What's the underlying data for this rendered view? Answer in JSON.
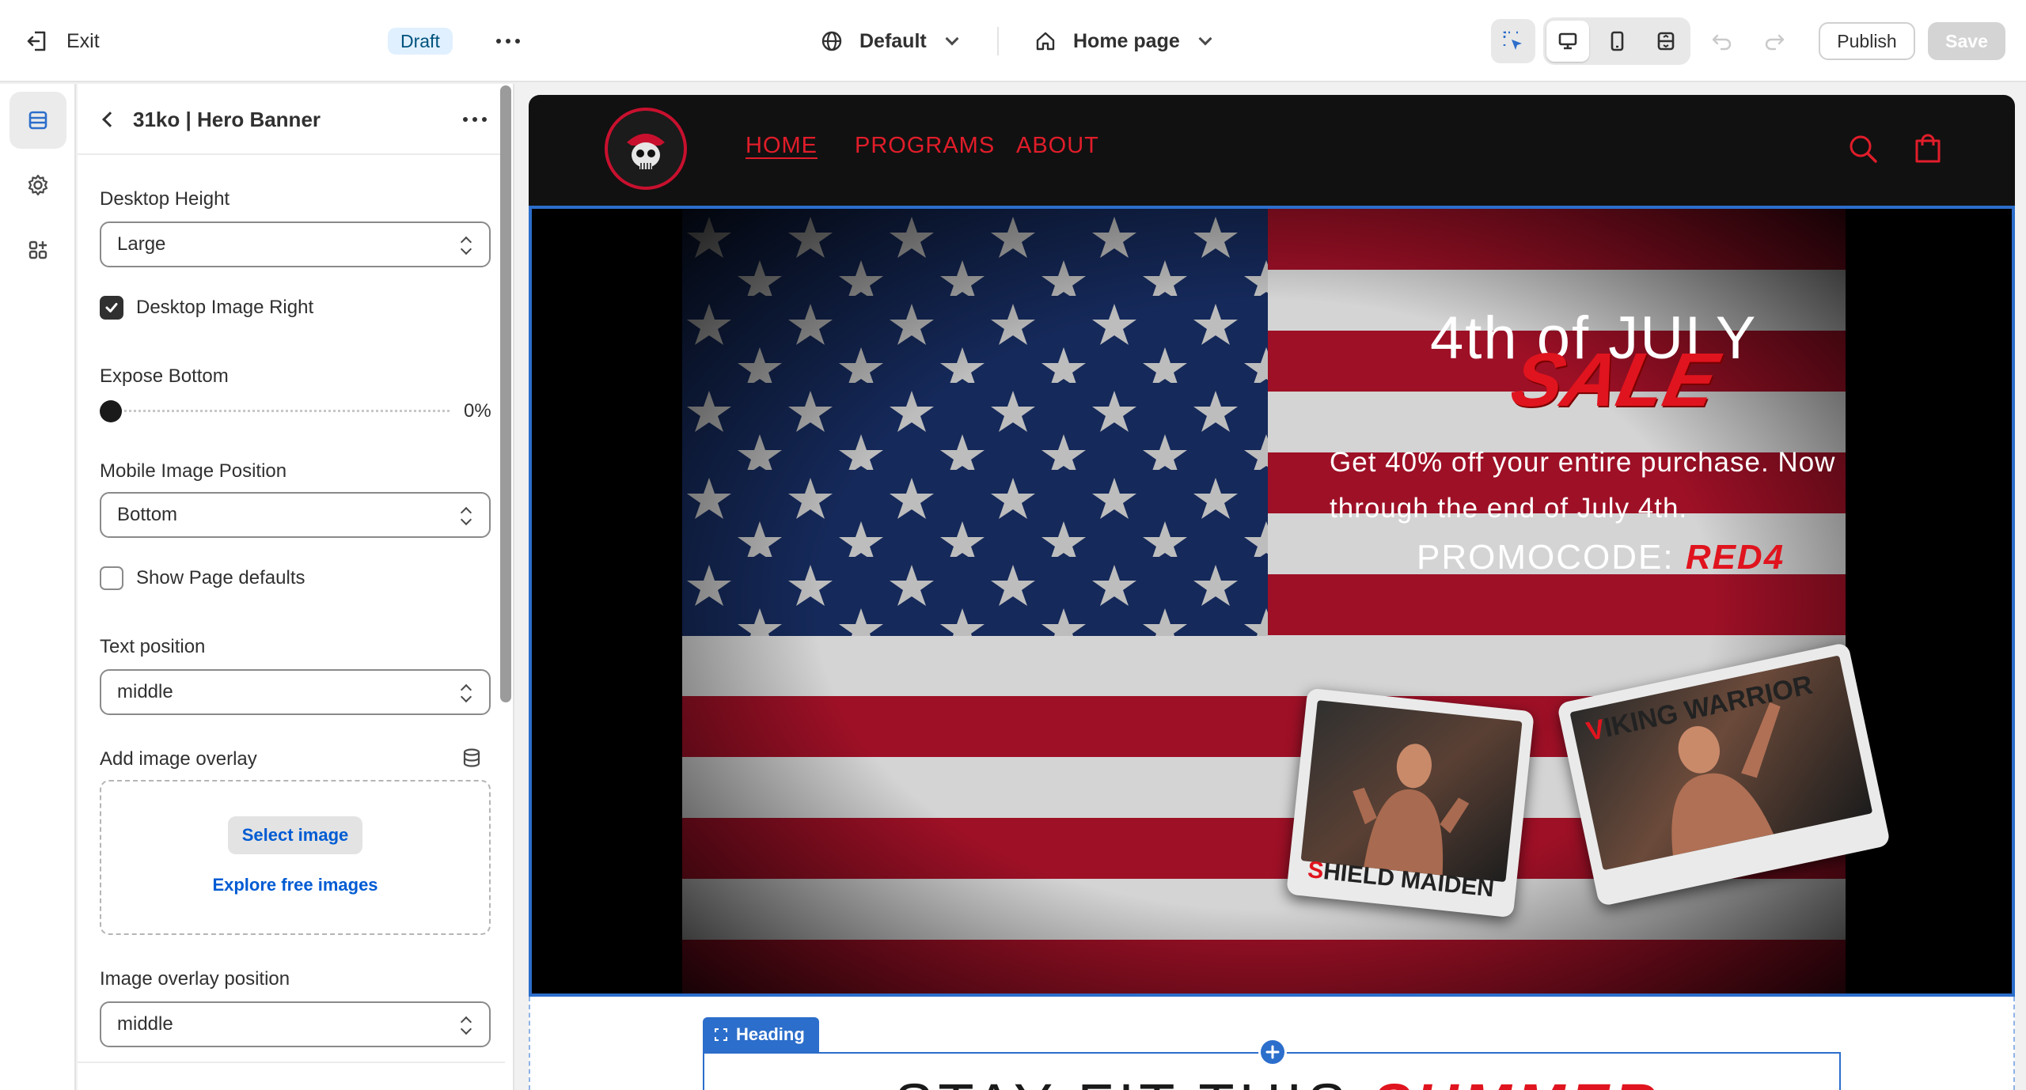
{
  "topbar": {
    "exit_label": "Exit",
    "status_badge": "Draft",
    "theme_select": "Default",
    "page_select": "Home page",
    "publish_label": "Publish",
    "save_label": "Save"
  },
  "panel": {
    "title": "31ko | Hero Banner",
    "desktop_height": {
      "label": "Desktop Height",
      "value": "Large"
    },
    "desktop_image_right": {
      "label": "Desktop Image Right",
      "checked": true
    },
    "expose_bottom": {
      "label": "Expose Bottom",
      "value": "0%"
    },
    "mobile_image_position": {
      "label": "Mobile Image Position",
      "value": "Bottom"
    },
    "show_page_defaults": {
      "label": "Show Page defaults",
      "checked": false
    },
    "text_position": {
      "label": "Text position",
      "value": "middle"
    },
    "image_overlay": {
      "label": "Add image overlay",
      "select_button": "Select image",
      "explore_link": "Explore free images"
    },
    "overlay_position": {
      "label": "Image overlay position",
      "value": "middle"
    }
  },
  "site": {
    "nav": [
      "HOME",
      "PROGRAMS",
      "ABOUT"
    ],
    "hero": {
      "title": "4th of JULY",
      "sale": "SALE",
      "body": "Get 40% off your entire purchase. Now through the end of July 4th.",
      "promo_prefix": "PROMOCODE:",
      "promo_code": "RED4",
      "photo_right_rest": "IKING WARRIOR",
      "photo_right_initial": "V",
      "photo_left_initial": "S",
      "photo_left_rest": "HIELD MAIDEN"
    },
    "heading_badge": "Heading",
    "heading_text": "STAY FIT THIS",
    "heading_red": "SUMMER"
  },
  "colors": {
    "accent": "#2c6ecb",
    "brand_red": "#e0141e",
    "draft_bg": "#e0f0ff"
  },
  "icons": [
    "exit-icon",
    "more-icon",
    "globe-icon",
    "home-icon",
    "inspector-icon",
    "desktop-icon",
    "mobile-icon",
    "full-width-icon",
    "undo-icon",
    "redo-icon",
    "sections-icon",
    "gear-icon",
    "apps-icon",
    "database-icon",
    "search-icon",
    "cart-icon"
  ]
}
